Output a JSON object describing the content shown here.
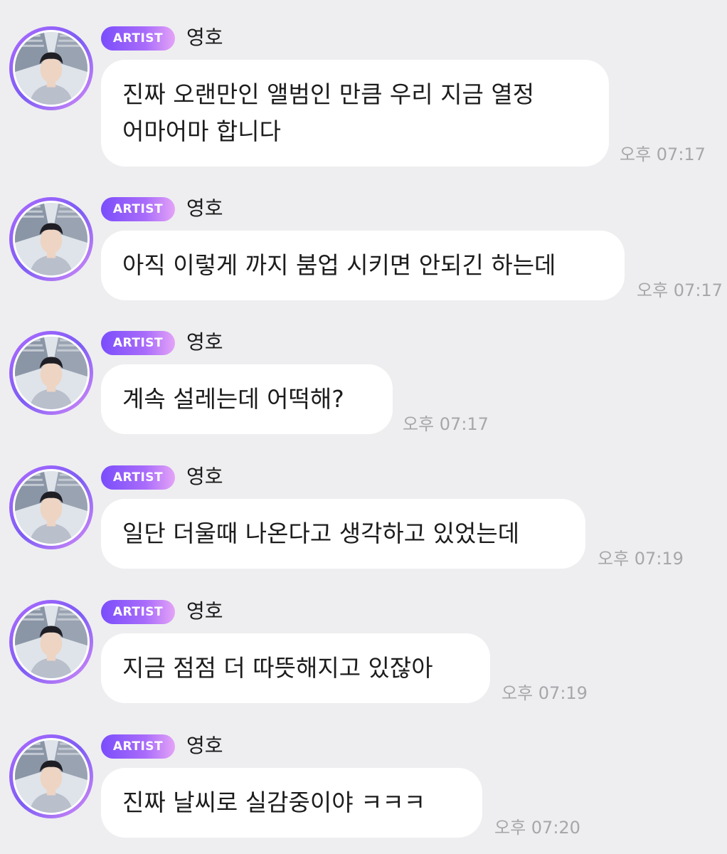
{
  "badge_label": "ARTIST",
  "sender_name": "영호",
  "messages": [
    {
      "text": "진짜 오랜만인 앨범인 만큼 우리 지금 열정\n어마어마 합니다",
      "time": "오후 07:17"
    },
    {
      "text": "아직 이렇게 까지 붐업 시키면 안되긴 하는데",
      "time": "오후 07:17"
    },
    {
      "text": "계속 설레는데 어떡해?",
      "time": "오후 07:17"
    },
    {
      "text": "일단 더울때 나온다고 생각하고 있었는데",
      "time": "오후 07:19"
    },
    {
      "text": "지금 점점 더 따뜻해지고 있잖아",
      "time": "오후 07:19"
    },
    {
      "text": "진짜 날씨로 실감중이야 ㅋㅋㅋ",
      "time": "오후 07:20"
    }
  ]
}
